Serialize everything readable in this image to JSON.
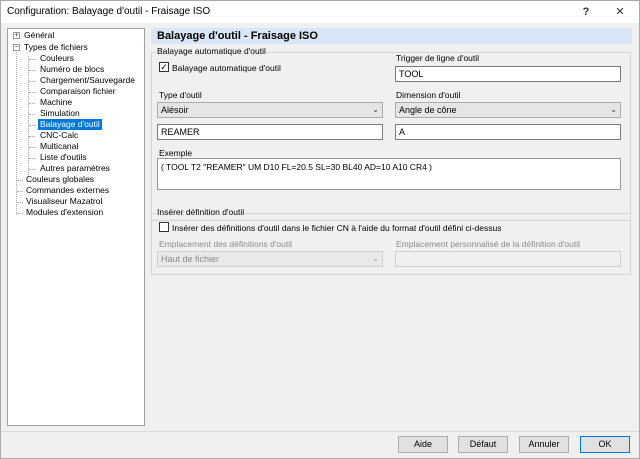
{
  "window": {
    "title": "Configuration: Balayage d'outil - Fraisage ISO",
    "help": "?",
    "close": "✕"
  },
  "tree": {
    "items": [
      {
        "label": "Général"
      },
      {
        "label": "Types de fichiers"
      },
      {
        "label": "Couleurs"
      },
      {
        "label": "Numéro de blocs"
      },
      {
        "label": "Chargement/Sauvegarde"
      },
      {
        "label": "Comparaison fichier"
      },
      {
        "label": "Machine"
      },
      {
        "label": "Simulation"
      },
      {
        "label": "Balayage d'outil"
      },
      {
        "label": "CNC-Calc"
      },
      {
        "label": "Multicanal"
      },
      {
        "label": "Liste d'outils"
      },
      {
        "label": "Autres paramètres"
      },
      {
        "label": "Couleurs globales"
      },
      {
        "label": "Commandes externes"
      },
      {
        "label": "Visualiseur Mazatrol"
      },
      {
        "label": "Modules d'extension"
      }
    ],
    "expander_collapsed": "+",
    "expander_expanded": "−"
  },
  "panel": {
    "title": "Balayage d'outil - Fraisage ISO",
    "auto_group": {
      "label": "Balayage automatique d'outil",
      "checkbox_label": "Balayage automatique d'outil",
      "checkmark": "✓",
      "trigger_label": "Trigger de ligne d'outil",
      "trigger_value": "TOOL",
      "tool_type_label": "Type d'outil",
      "tool_type_value": "Alésoir",
      "dimension_label": "Dimension d'outil",
      "dimension_value": "Angle de cône",
      "tool_type_text": "REAMER",
      "dimension_text": "A",
      "example_label": "Exemple",
      "example_text": "( TOOL T2 \"REAMER\" UM D10 FL=20.5 SL=30 BL40 AD=10 A10 CR4 )"
    },
    "insert_group": {
      "label": "Insérer définition d'outil",
      "checkbox_label": "Insérer des définitions d'outil dans le fichier CN à l'aide du format d'outil défini ci-dessus",
      "location_label": "Emplacement des définitions d'outil",
      "location_value": "Haut de fichier",
      "custom_label": "Emplacement personnalisé de la définition d'outil",
      "custom_value": ""
    },
    "arrow": "⌄"
  },
  "footer": {
    "help": "Aide",
    "default": "Défaut",
    "cancel": "Annuler",
    "ok": "OK"
  }
}
